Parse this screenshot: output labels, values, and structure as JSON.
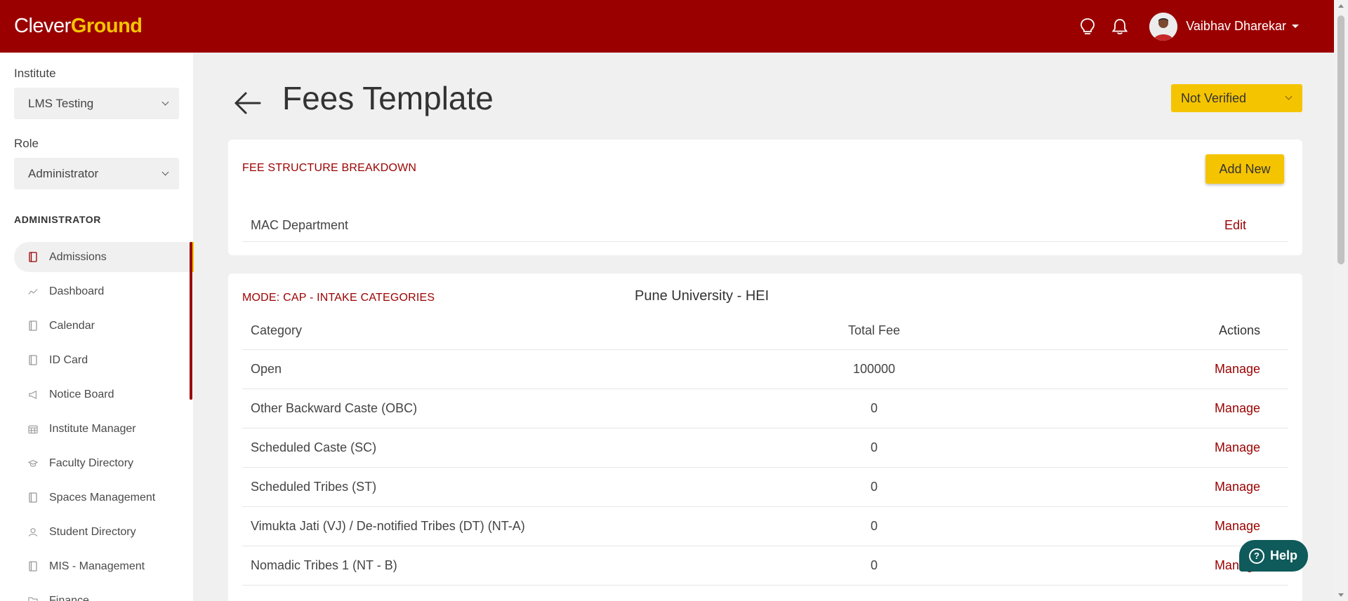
{
  "header": {
    "logo_part1": "Clever",
    "logo_part2": "Ground",
    "user_name": "Vaibhav Dharekar",
    "brand_color": "#9b0000",
    "accent_color": "#f5c400",
    "icons": [
      "lightbulb-icon",
      "bell-icon"
    ]
  },
  "sidebar": {
    "institute_label": "Institute",
    "institute_value": "LMS Testing",
    "role_label": "Role",
    "role_value": "Administrator",
    "section_title": "ADMINISTRATOR",
    "items": [
      {
        "label": "Admissions",
        "icon": "book-icon",
        "active": true
      },
      {
        "label": "Dashboard",
        "icon": "trend-line-icon"
      },
      {
        "label": "Calendar",
        "icon": "book-icon"
      },
      {
        "label": "ID Card",
        "icon": "book-icon"
      },
      {
        "label": "Notice Board",
        "icon": "megaphone-icon"
      },
      {
        "label": "Institute Manager",
        "icon": "calendar-grid-icon"
      },
      {
        "label": "Faculty Directory",
        "icon": "graduation-cap-icon"
      },
      {
        "label": "Spaces Management",
        "icon": "book-icon"
      },
      {
        "label": "Student Directory",
        "icon": "user-icon"
      },
      {
        "label": "MIS - Management",
        "icon": "book-icon"
      },
      {
        "label": "Finance",
        "icon": "folder-icon"
      }
    ]
  },
  "main": {
    "title": "Fees Template",
    "status": "Not Verified",
    "fee_structure": {
      "title": "FEE STRUCTURE BREAKDOWN",
      "add_label": "Add New",
      "department": "MAC Department",
      "edit_label": "Edit"
    },
    "intake": {
      "title": "MODE: CAP - INTAKE CATEGORIES",
      "university": "Pune University - HEI",
      "columns": [
        "Category",
        "Total Fee",
        "Actions"
      ],
      "rows": [
        {
          "category": "Open",
          "fee": "100000",
          "action": "Manage"
        },
        {
          "category": "Other Backward Caste (OBC)",
          "fee": "0",
          "action": "Manage"
        },
        {
          "category": "Scheduled Caste (SC)",
          "fee": "0",
          "action": "Manage"
        },
        {
          "category": "Scheduled Tribes (ST)",
          "fee": "0",
          "action": "Manage"
        },
        {
          "category": "Vimukta Jati (VJ) / De-notified Tribes (DT) (NT-A)",
          "fee": "0",
          "action": "Manage"
        },
        {
          "category": "Nomadic Tribes 1 (NT - B)",
          "fee": "0",
          "action": "Manage"
        }
      ]
    }
  },
  "help": {
    "label": "Help"
  }
}
